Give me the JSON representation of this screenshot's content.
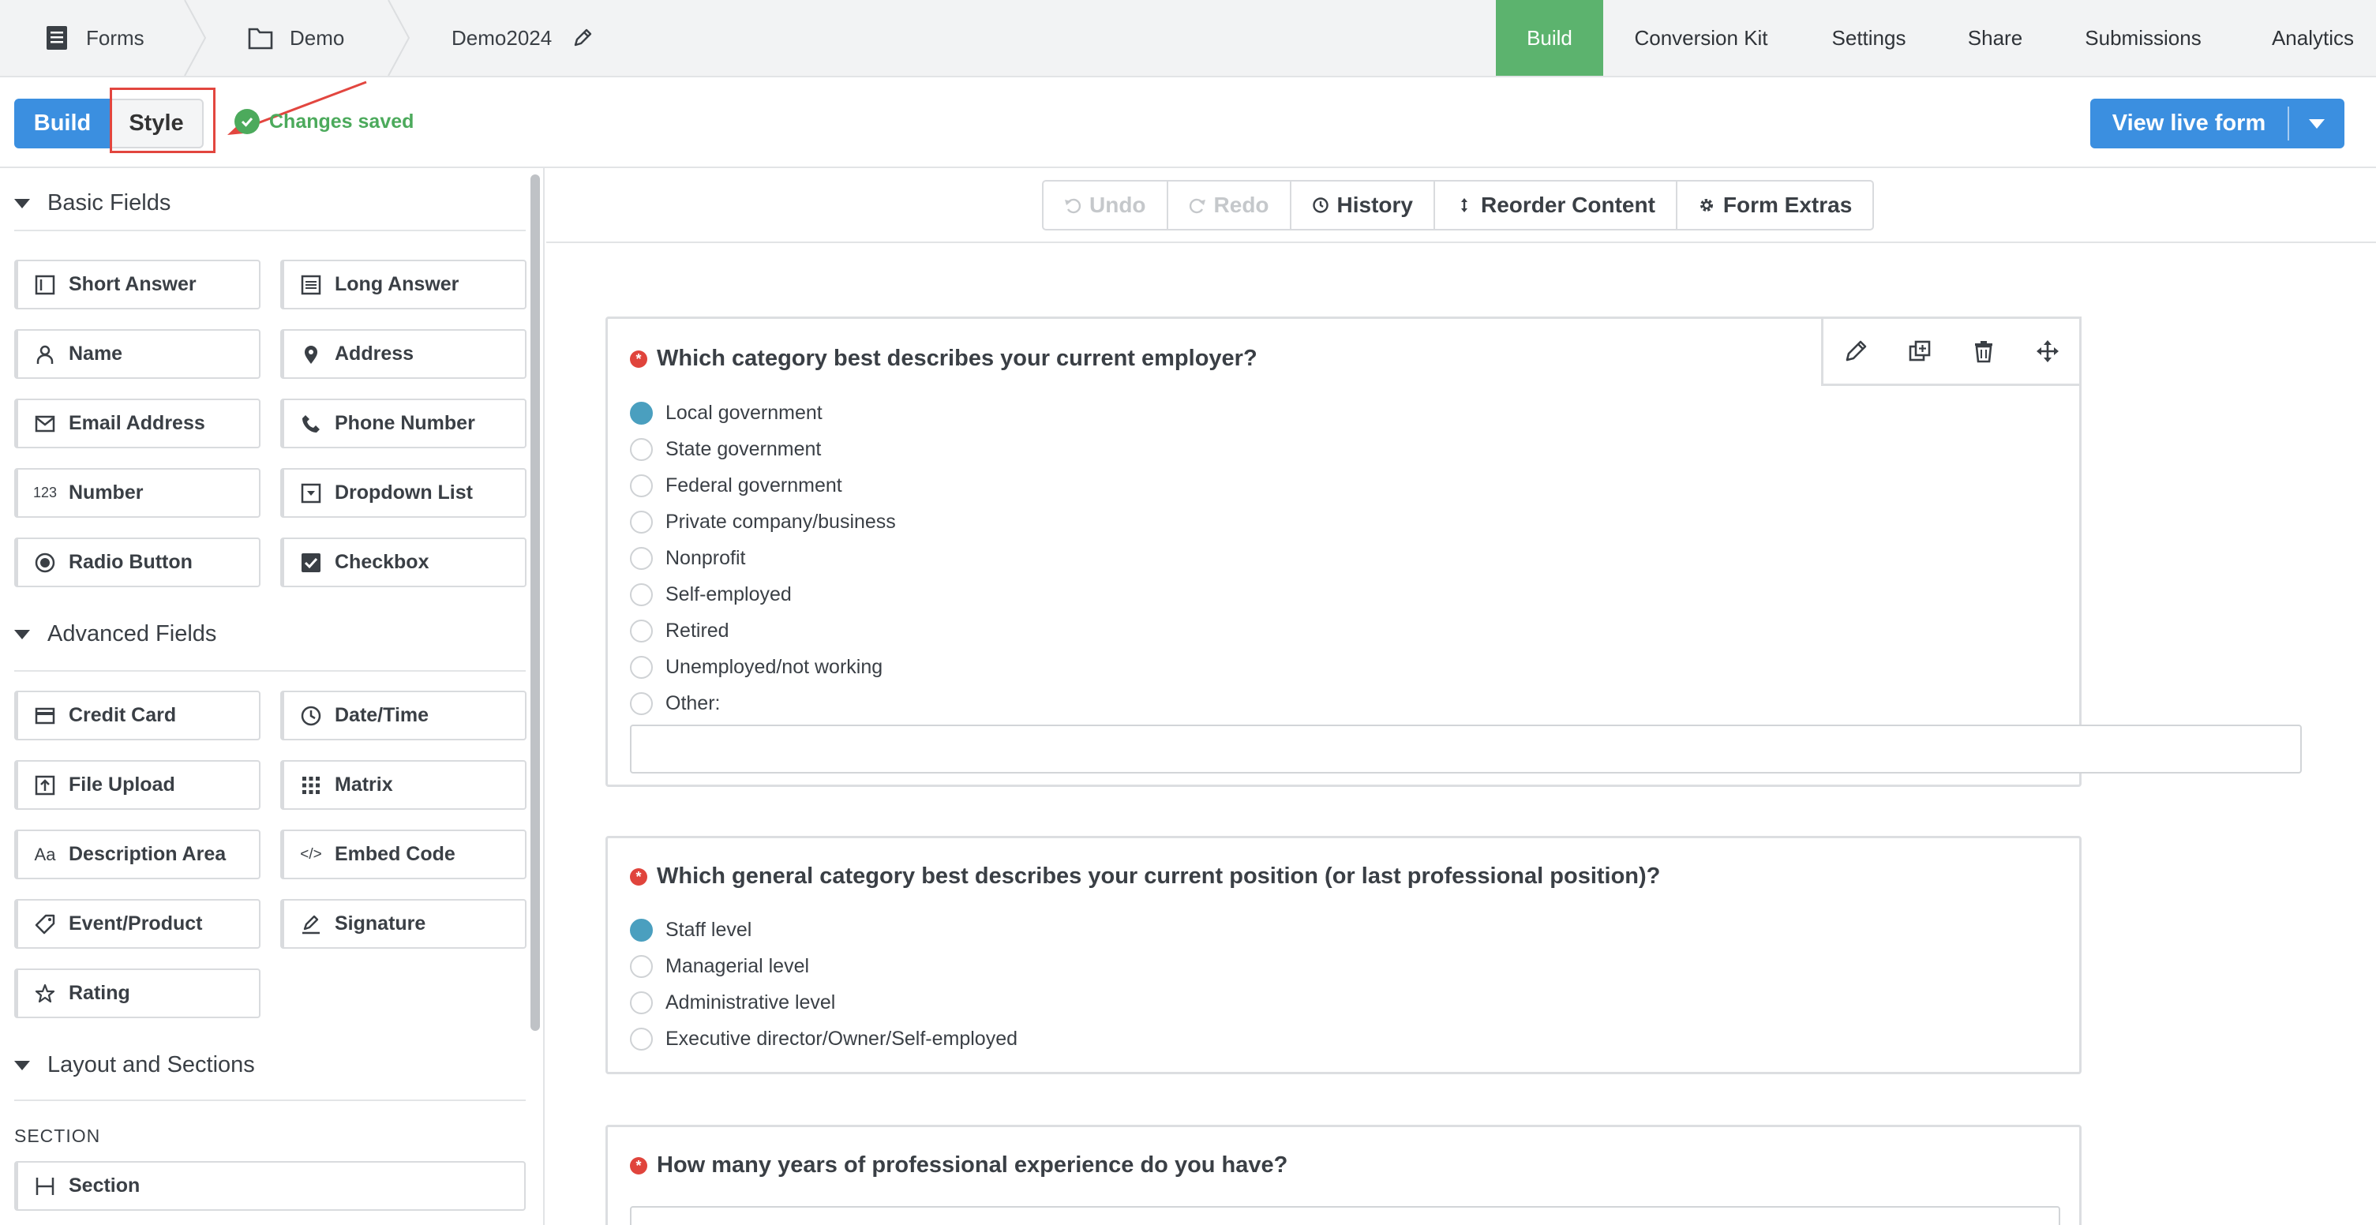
{
  "breadcrumbs": {
    "forms": "Forms",
    "folder": "Demo",
    "form_name": "Demo2024"
  },
  "nav_tabs": [
    "Build",
    "Conversion Kit",
    "Settings",
    "Share",
    "Submissions",
    "Analytics"
  ],
  "toolbar": {
    "build_label": "Build",
    "style_label": "Style",
    "saved_status": "Changes saved",
    "view_live_label": "View live form"
  },
  "sidebar": {
    "basic_title": "Basic Fields",
    "basic": [
      {
        "label": "Short Answer",
        "icon": "short-answer-icon"
      },
      {
        "label": "Long Answer",
        "icon": "long-answer-icon"
      },
      {
        "label": "Name",
        "icon": "person-icon"
      },
      {
        "label": "Address",
        "icon": "map-pin-icon"
      },
      {
        "label": "Email Address",
        "icon": "envelope-icon"
      },
      {
        "label": "Phone Number",
        "icon": "phone-icon"
      },
      {
        "label": "Number",
        "icon": "number-123-icon"
      },
      {
        "label": "Dropdown List",
        "icon": "dropdown-icon"
      },
      {
        "label": "Radio Button",
        "icon": "radio-icon"
      },
      {
        "label": "Checkbox",
        "icon": "checkbox-icon"
      }
    ],
    "advanced_title": "Advanced Fields",
    "advanced": [
      {
        "label": "Credit Card",
        "icon": "credit-card-icon"
      },
      {
        "label": "Date/Time",
        "icon": "clock-icon"
      },
      {
        "label": "File Upload",
        "icon": "file-upload-icon"
      },
      {
        "label": "Matrix",
        "icon": "matrix-grid-icon"
      },
      {
        "label": "Description Area",
        "icon": "text-aa-icon"
      },
      {
        "label": "Embed Code",
        "icon": "code-icon"
      },
      {
        "label": "Event/Product",
        "icon": "tag-icon"
      },
      {
        "label": "Signature",
        "icon": "pen-icon"
      },
      {
        "label": "Rating",
        "icon": "star-icon"
      }
    ],
    "layout_title": "Layout and Sections",
    "section_sub": "SECTION",
    "section_button": "Section"
  },
  "edit_tools": {
    "undo": "Undo",
    "redo": "Redo",
    "history": "History",
    "reorder": "Reorder Content",
    "extras": "Form Extras"
  },
  "questions": [
    {
      "title": "Which category best describes your current employer?",
      "options": [
        "Local government",
        "State government",
        "Federal government",
        "Private company/business",
        "Nonprofit",
        "Self-employed",
        "Retired",
        "Unemployed/not working",
        "Other:"
      ],
      "selected": 0
    },
    {
      "title": "Which general category best describes your current position (or last professional position)?",
      "options": [
        "Staff level",
        "Managerial level",
        "Administrative level",
        "Executive director/Owner/Self-employed"
      ],
      "selected": 0
    },
    {
      "title": "How many years of professional experience do you have?"
    }
  ],
  "colors": {
    "primary": "#3b8fe0",
    "active_tab": "#5cb36e",
    "success": "#4caa5c",
    "required": "#e0443c",
    "radio_selected": "#4a9fbf",
    "highlight": "#e2463f"
  }
}
